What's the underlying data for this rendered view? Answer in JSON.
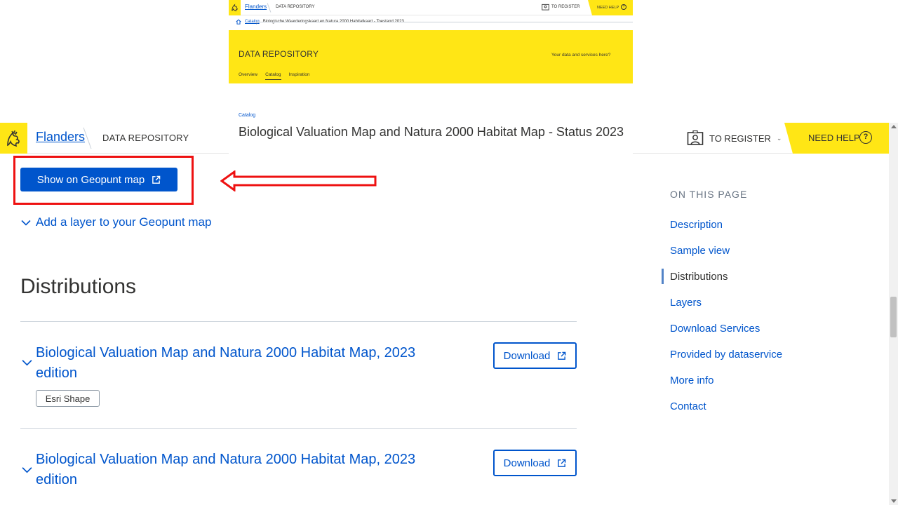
{
  "header": {
    "brand": "Flanders",
    "section": "DATA REPOSITORY",
    "register_label": "TO REGISTER",
    "help_label": "NEED HELP",
    "help_glyph": "?"
  },
  "inset": {
    "brand": "Flanders",
    "section": "DATA REPOSITORY",
    "register_label": "TO REGISTER",
    "help_label": "NEED HELP",
    "help_glyph": "?",
    "breadcrumb": {
      "catalog": "Catalog",
      "current": "Biologische Waarderingskaart en Natura 2000 Habitatkaart - Toestand 2023"
    },
    "band_title": "DATA REPOSITORY",
    "band_tagline": "Your data and services here?",
    "nav": [
      "Overview",
      "Catalog",
      "Inspiration"
    ],
    "nav_active": "Catalog",
    "catalog_label": "Catalog",
    "page_title": "Biological Valuation Map and Natura 2000 Habitat Map - Status 2023"
  },
  "main": {
    "geopunt_button": "Show on Geopunt map",
    "add_layer_label": "Add a layer to your Geopunt map",
    "section_title": "Distributions",
    "distributions": [
      {
        "title": "Biological Valuation Map and Natura 2000 Habitat Map, 2023 edition",
        "download_label": "Download",
        "format_tag": "Esri Shape"
      },
      {
        "title": "Biological Valuation Map and Natura 2000 Habitat Map, 2023 edition",
        "download_label": "Download"
      }
    ]
  },
  "toc": {
    "title": "ON THIS PAGE",
    "items": [
      "Description",
      "Sample view",
      "Distributions",
      "Layers",
      "Download Services",
      "Provided by dataservice",
      "More info",
      "Contact"
    ],
    "active": "Distributions"
  },
  "colors": {
    "brand_yellow": "#ffe615",
    "link_blue": "#0055cc",
    "annotation_red": "#ee1111"
  },
  "icons": {
    "logo": "flanders-lion-icon",
    "register": "id-card-icon",
    "external": "external-link-icon",
    "chevron": "chevron-down-icon",
    "home": "home-icon"
  }
}
